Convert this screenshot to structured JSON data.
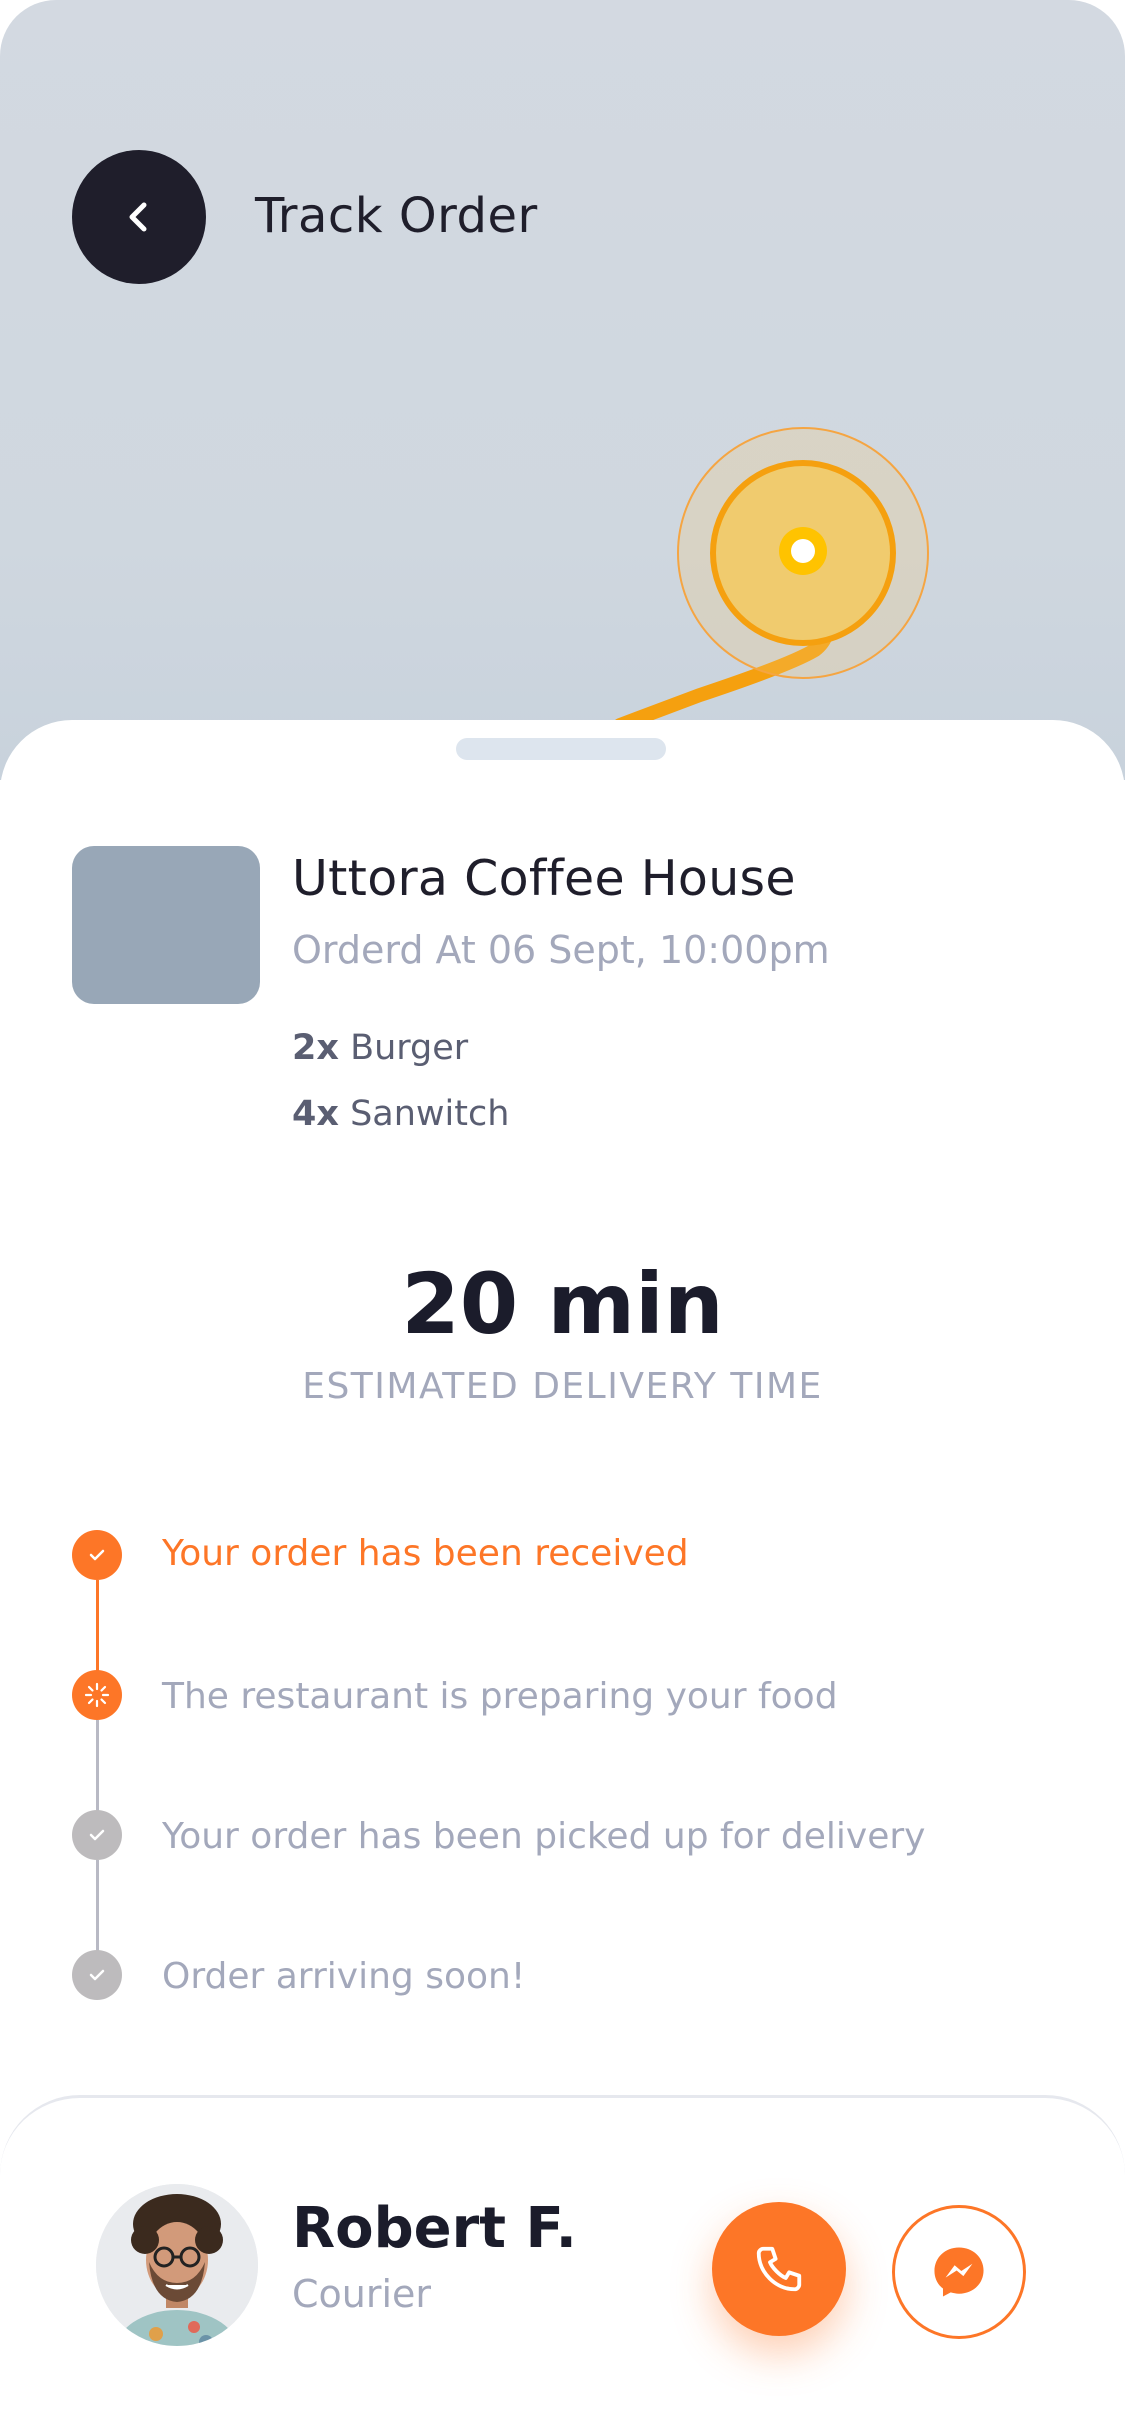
{
  "header": {
    "title": "Track Order",
    "back_icon": "chevron-left-icon"
  },
  "order": {
    "restaurant": "Uttora Coffee House",
    "ordered_at": "Orderd At 06 Sept, 10:00pm",
    "items": [
      {
        "qty": "2x",
        "name": "Burger"
      },
      {
        "qty": "4x",
        "name": "Sanwitch"
      }
    ]
  },
  "eta": {
    "value": "20 min",
    "label": "ESTIMATED DELIVERY TIME"
  },
  "steps": [
    {
      "text": "Your order has been received",
      "status": "done"
    },
    {
      "text": "The restaurant is preparing your food",
      "status": "in-progress"
    },
    {
      "text": "Your order has been picked up for delivery",
      "status": "pending"
    },
    {
      "text": "Order arriving soon!",
      "status": "pending"
    }
  ],
  "courier": {
    "name": "Robert F.",
    "role": "Courier",
    "call_icon": "phone-icon",
    "message_icon": "messenger-icon"
  },
  "colors": {
    "accent": "#fd7627",
    "dark": "#1f1e2b",
    "muted": "#a3a8bb",
    "pending": "#bdbbbd",
    "map_bg": "#d3d9e1",
    "route": "#f5a00f"
  }
}
